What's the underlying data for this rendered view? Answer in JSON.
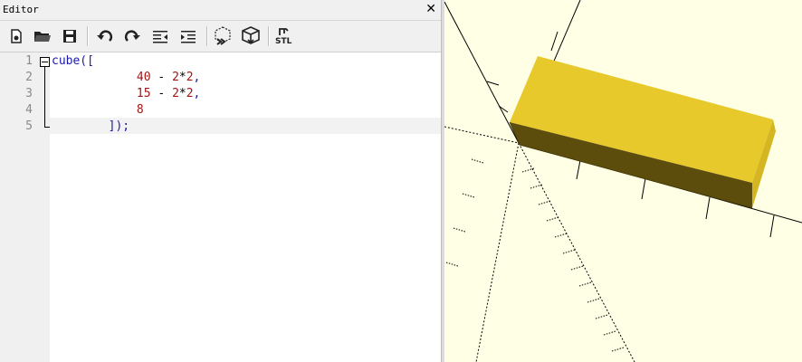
{
  "editor": {
    "title": "Editor",
    "close_glyph": "✕"
  },
  "toolbar": {
    "buttons": [
      {
        "name": "new-file",
        "icon": "new-file-icon"
      },
      {
        "name": "open-file",
        "icon": "folder-open-icon"
      },
      {
        "name": "save-file",
        "icon": "save-icon"
      },
      {
        "name": "undo",
        "icon": "undo-icon"
      },
      {
        "name": "redo",
        "icon": "redo-icon"
      },
      {
        "name": "unindent",
        "icon": "unindent-icon"
      },
      {
        "name": "indent",
        "icon": "indent-icon"
      },
      {
        "name": "preview",
        "icon": "preview-icon"
      },
      {
        "name": "render",
        "icon": "render-icon"
      },
      {
        "name": "export-stl",
        "icon": "stl-export-icon",
        "label": "STL"
      }
    ]
  },
  "code": {
    "line_numbers": [
      "1",
      "2",
      "3",
      "4",
      "5"
    ],
    "lines": [
      [
        {
          "t": "kw",
          "v": "cube(["
        }
      ],
      [
        {
          "t": "op",
          "v": "            "
        },
        {
          "t": "num",
          "v": "40"
        },
        {
          "t": "op",
          "v": " - "
        },
        {
          "t": "num",
          "v": "2"
        },
        {
          "t": "op",
          "v": "*"
        },
        {
          "t": "num",
          "v": "2"
        },
        {
          "t": "kw",
          "v": ","
        }
      ],
      [
        {
          "t": "op",
          "v": "            "
        },
        {
          "t": "num",
          "v": "15"
        },
        {
          "t": "op",
          "v": " - "
        },
        {
          "t": "num",
          "v": "2"
        },
        {
          "t": "op",
          "v": "*"
        },
        {
          "t": "num",
          "v": "2"
        },
        {
          "t": "kw",
          "v": ","
        }
      ],
      [
        {
          "t": "op",
          "v": "            "
        },
        {
          "t": "num",
          "v": "8"
        }
      ],
      [
        {
          "t": "op",
          "v": "        "
        },
        {
          "t": "kw",
          "v": "]);"
        }
      ]
    ]
  },
  "viewport": {
    "background": "#ffffe5",
    "object": "cube",
    "top_face_color": "#e8c92c",
    "front_face_color": "#5c4d0c",
    "side_face_color": "#d4b522"
  }
}
